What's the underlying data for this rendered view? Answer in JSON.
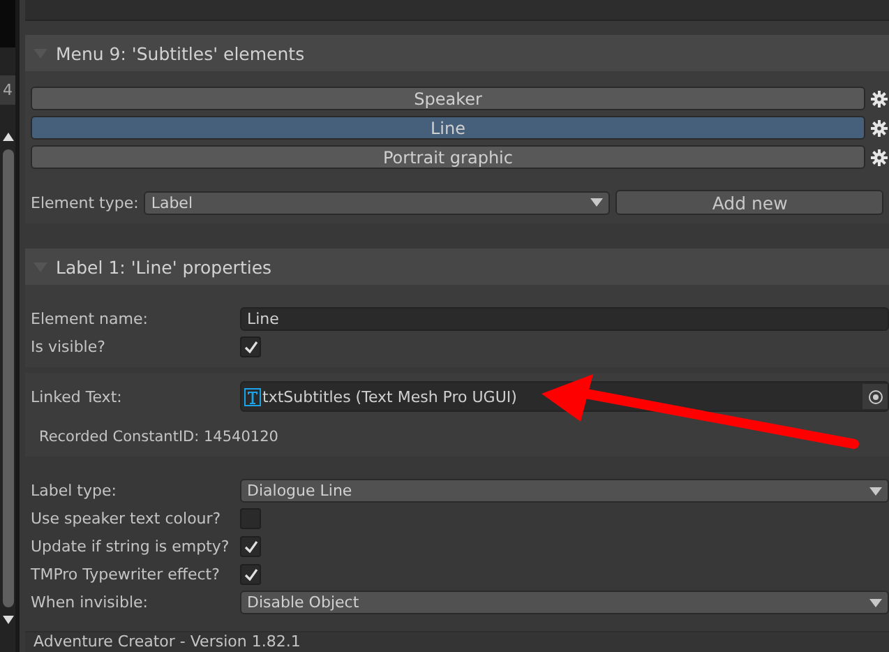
{
  "left_strip": {
    "index_label": "4"
  },
  "menu_section": {
    "title": "Menu 9: 'Subtitles' elements",
    "expanded": true,
    "elements": [
      {
        "label": "Speaker",
        "selected": false
      },
      {
        "label": "Line",
        "selected": true
      },
      {
        "label": "Portrait graphic",
        "selected": false
      }
    ],
    "element_type": {
      "label": "Element type:",
      "value": "Label"
    },
    "add_button": "Add new"
  },
  "label_section": {
    "title": "Label 1: 'Line' properties",
    "expanded": true,
    "element_name": {
      "label": "Element name:",
      "value": "Line"
    },
    "is_visible": {
      "label": "Is visible?",
      "checked": true
    },
    "linked_text": {
      "label": "Linked Text:",
      "value": "txtSubtitles (Text Mesh Pro UGUI)"
    },
    "constant_id": "Recorded ConstantID: 14540120",
    "fields": [
      {
        "kind": "dropdown",
        "label": "Label type:",
        "value": "Dialogue Line"
      },
      {
        "kind": "checkbox",
        "label": "Use speaker text colour?",
        "checked": false
      },
      {
        "kind": "checkbox",
        "label": "Update if string is empty?",
        "checked": true
      },
      {
        "kind": "checkbox",
        "label": "TMPro Typewriter effect?",
        "checked": true
      },
      {
        "kind": "dropdown",
        "label": "When invisible:",
        "value": "Disable Object"
      }
    ]
  },
  "footer": "Adventure Creator - Version 1.82.1"
}
